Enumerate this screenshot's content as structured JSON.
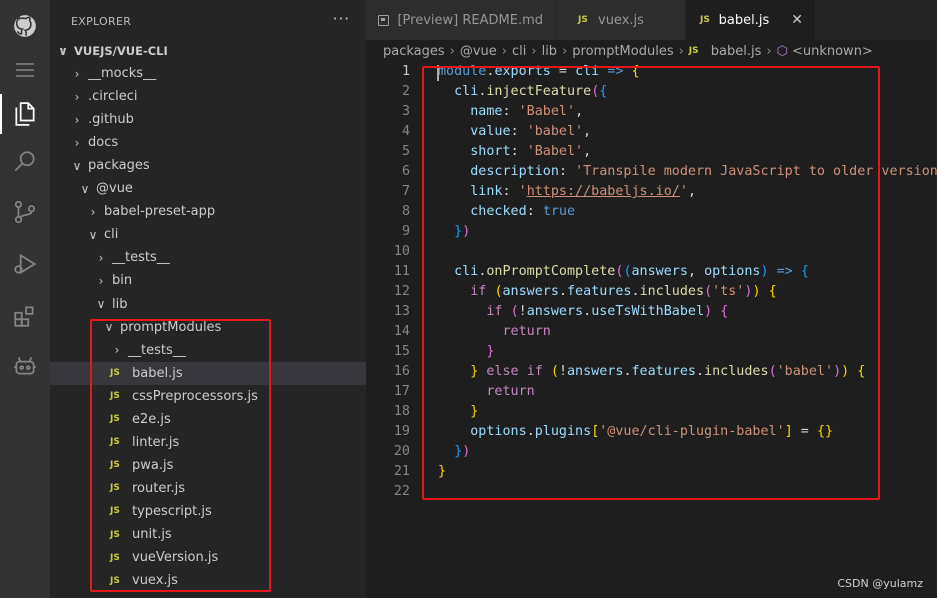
{
  "sidebar": {
    "title": "EXPLORER",
    "more": "···",
    "root": "VUEJS/VUE-CLI",
    "items": [
      {
        "label": "__mocks__",
        "type": "folder",
        "open": false,
        "depth": 1
      },
      {
        "label": ".circleci",
        "type": "folder",
        "open": false,
        "depth": 1
      },
      {
        "label": ".github",
        "type": "folder",
        "open": false,
        "depth": 1
      },
      {
        "label": "docs",
        "type": "folder",
        "open": false,
        "depth": 1
      },
      {
        "label": "packages",
        "type": "folder",
        "open": true,
        "depth": 1
      },
      {
        "label": "@vue",
        "type": "folder",
        "open": true,
        "depth": 2
      },
      {
        "label": "babel-preset-app",
        "type": "folder",
        "open": false,
        "depth": 3
      },
      {
        "label": "cli",
        "type": "folder",
        "open": true,
        "depth": 3
      },
      {
        "label": "__tests__",
        "type": "folder",
        "open": false,
        "depth": 4
      },
      {
        "label": "bin",
        "type": "folder",
        "open": false,
        "depth": 4
      },
      {
        "label": "lib",
        "type": "folder",
        "open": true,
        "depth": 4
      },
      {
        "label": "promptModules",
        "type": "folder",
        "open": true,
        "depth": 5
      },
      {
        "label": "__tests__",
        "type": "folder",
        "open": false,
        "depth": 6
      },
      {
        "label": "babel.js",
        "type": "file",
        "depth": 6,
        "selected": true
      },
      {
        "label": "cssPreprocessors.js",
        "type": "file",
        "depth": 6
      },
      {
        "label": "e2e.js",
        "type": "file",
        "depth": 6
      },
      {
        "label": "linter.js",
        "type": "file",
        "depth": 6
      },
      {
        "label": "pwa.js",
        "type": "file",
        "depth": 6
      },
      {
        "label": "router.js",
        "type": "file",
        "depth": 6
      },
      {
        "label": "typescript.js",
        "type": "file",
        "depth": 6
      },
      {
        "label": "unit.js",
        "type": "file",
        "depth": 6
      },
      {
        "label": "vueVersion.js",
        "type": "file",
        "depth": 6
      },
      {
        "label": "vuex.js",
        "type": "file",
        "depth": 6
      }
    ]
  },
  "file_icon_text": "JS",
  "tabs": [
    {
      "label": "[Preview] README.md",
      "icon": "preview-icon",
      "active": false
    },
    {
      "label": "vuex.js",
      "icon": "js-icon",
      "active": false
    },
    {
      "label": "babel.js",
      "icon": "js-icon",
      "active": true,
      "close": "✕"
    }
  ],
  "breadcrumb": {
    "parts": [
      "packages",
      "@vue",
      "cli",
      "lib",
      "promptModules"
    ],
    "file": "babel.js",
    "symbol": "<unknown>"
  },
  "code_lines": [
    [
      [
        "b",
        "module"
      ],
      [
        "p",
        "."
      ],
      [
        "v",
        "exports"
      ],
      [
        "p",
        " = "
      ],
      [
        "v",
        "cli"
      ],
      [
        "p",
        " "
      ],
      [
        "b",
        "=>"
      ],
      [
        "p",
        " "
      ],
      [
        "br1",
        "{"
      ]
    ],
    [
      [
        "p",
        "  "
      ],
      [
        "v",
        "cli"
      ],
      [
        "p",
        "."
      ],
      [
        "f",
        "injectFeature"
      ],
      [
        "br2",
        "("
      ],
      [
        "br3",
        "{"
      ]
    ],
    [
      [
        "p",
        "    "
      ],
      [
        "v",
        "name"
      ],
      [
        "p",
        ": "
      ],
      [
        "s",
        "'Babel'"
      ],
      [
        "p",
        ","
      ]
    ],
    [
      [
        "p",
        "    "
      ],
      [
        "v",
        "value"
      ],
      [
        "p",
        ": "
      ],
      [
        "s",
        "'babel'"
      ],
      [
        "p",
        ","
      ]
    ],
    [
      [
        "p",
        "    "
      ],
      [
        "v",
        "short"
      ],
      [
        "p",
        ": "
      ],
      [
        "s",
        "'Babel'"
      ],
      [
        "p",
        ","
      ]
    ],
    [
      [
        "p",
        "    "
      ],
      [
        "v",
        "description"
      ],
      [
        "p",
        ": "
      ],
      [
        "s",
        "'Transpile modern JavaScript to older versions"
      ]
    ],
    [
      [
        "p",
        "    "
      ],
      [
        "v",
        "link"
      ],
      [
        "p",
        ": "
      ],
      [
        "s",
        "'"
      ],
      [
        "u",
        "https://babeljs.io/"
      ],
      [
        "s",
        "'"
      ],
      [
        "p",
        ","
      ]
    ],
    [
      [
        "p",
        "    "
      ],
      [
        "v",
        "checked"
      ],
      [
        "p",
        ": "
      ],
      [
        "b",
        "true"
      ]
    ],
    [
      [
        "p",
        "  "
      ],
      [
        "br3",
        "}"
      ],
      [
        "br2",
        ")"
      ]
    ],
    [],
    [
      [
        "p",
        "  "
      ],
      [
        "v",
        "cli"
      ],
      [
        "p",
        "."
      ],
      [
        "f",
        "onPromptComplete"
      ],
      [
        "br2",
        "("
      ],
      [
        "br3",
        "("
      ],
      [
        "v",
        "answers"
      ],
      [
        "p",
        ", "
      ],
      [
        "v",
        "options"
      ],
      [
        "br3",
        ")"
      ],
      [
        "p",
        " "
      ],
      [
        "b",
        "=>"
      ],
      [
        "p",
        " "
      ],
      [
        "br3",
        "{"
      ]
    ],
    [
      [
        "p",
        "    "
      ],
      [
        "k",
        "if"
      ],
      [
        "p",
        " "
      ],
      [
        "br1",
        "("
      ],
      [
        "v",
        "answers"
      ],
      [
        "p",
        "."
      ],
      [
        "v",
        "features"
      ],
      [
        "p",
        "."
      ],
      [
        "f",
        "includes"
      ],
      [
        "br2",
        "("
      ],
      [
        "s",
        "'ts'"
      ],
      [
        "br2",
        ")"
      ],
      [
        "br1",
        ")"
      ],
      [
        "p",
        " "
      ],
      [
        "br1",
        "{"
      ]
    ],
    [
      [
        "p",
        "      "
      ],
      [
        "k",
        "if"
      ],
      [
        "p",
        " "
      ],
      [
        "br2",
        "("
      ],
      [
        "p",
        "!"
      ],
      [
        "v",
        "answers"
      ],
      [
        "p",
        "."
      ],
      [
        "v",
        "useTsWithBabel"
      ],
      [
        "br2",
        ")"
      ],
      [
        "p",
        " "
      ],
      [
        "br2",
        "{"
      ]
    ],
    [
      [
        "p",
        "        "
      ],
      [
        "k",
        "return"
      ]
    ],
    [
      [
        "p",
        "      "
      ],
      [
        "br2",
        "}"
      ]
    ],
    [
      [
        "p",
        "    "
      ],
      [
        "br1",
        "}"
      ],
      [
        "p",
        " "
      ],
      [
        "k",
        "else"
      ],
      [
        "p",
        " "
      ],
      [
        "k",
        "if"
      ],
      [
        "p",
        " "
      ],
      [
        "br1",
        "("
      ],
      [
        "p",
        "!"
      ],
      [
        "v",
        "answers"
      ],
      [
        "p",
        "."
      ],
      [
        "v",
        "features"
      ],
      [
        "p",
        "."
      ],
      [
        "f",
        "includes"
      ],
      [
        "br2",
        "("
      ],
      [
        "s",
        "'babel'"
      ],
      [
        "br2",
        ")"
      ],
      [
        "br1",
        ")"
      ],
      [
        "p",
        " "
      ],
      [
        "br1",
        "{"
      ]
    ],
    [
      [
        "p",
        "      "
      ],
      [
        "k",
        "return"
      ]
    ],
    [
      [
        "p",
        "    "
      ],
      [
        "br1",
        "}"
      ]
    ],
    [
      [
        "p",
        "    "
      ],
      [
        "v",
        "options"
      ],
      [
        "p",
        "."
      ],
      [
        "v",
        "plugins"
      ],
      [
        "br1",
        "["
      ],
      [
        "s",
        "'@vue/cli-plugin-babel'"
      ],
      [
        "br1",
        "]"
      ],
      [
        "p",
        " = "
      ],
      [
        "br1",
        "{}"
      ]
    ],
    [
      [
        "p",
        "  "
      ],
      [
        "br3",
        "}"
      ],
      [
        "br2",
        ")"
      ]
    ],
    [
      [
        "br1",
        "}"
      ]
    ],
    []
  ],
  "watermark": "CSDN @yulamz",
  "colors": {
    "annotation_red": "#e5161c",
    "js_yellow": "#cbcb41",
    "editor_bg": "#1e1e1e",
    "sidebar_bg": "#252526"
  }
}
